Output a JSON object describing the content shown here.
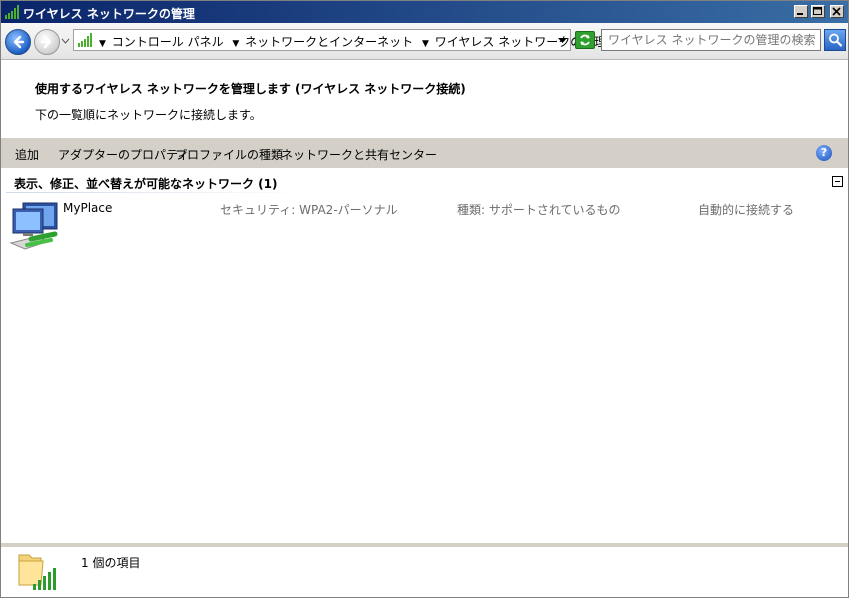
{
  "window": {
    "title": "ワイヤレス ネットワークの管理"
  },
  "address": {
    "crumbs": [
      "コントロール パネル",
      "ネットワークとインターネット",
      "ワイヤレス ネットワークの管理"
    ]
  },
  "search": {
    "placeholder": "ワイヤレス ネットワークの管理の検索"
  },
  "header": {
    "title": "使用するワイヤレス ネットワークを管理します (ワイヤレス ネットワーク接続)",
    "subtitle": "下の一覧順にネットワークに接続します。"
  },
  "toolbar": {
    "add": "追加",
    "adapter_properties": "アダプターのプロパティ",
    "profile_types": "プロファイルの種類",
    "network_center": "ネットワークと共有センター",
    "help": "?"
  },
  "group": {
    "title": "表示、修正、並べ替えが可能なネットワーク (1)"
  },
  "networks": [
    {
      "name": "MyPlace",
      "security": "セキュリティ: WPA2-パーソナル",
      "type": "種類: サポートされているもの",
      "connection": "自動的に接続する"
    }
  ],
  "details": {
    "count_text": "1 個の項目"
  },
  "icons": {
    "app": "wireless-network-icon",
    "back": "back-arrow-icon",
    "forward": "forward-arrow-icon",
    "refresh": "refresh-icon",
    "search": "search-icon",
    "network": "computer-network-icon",
    "details": "folder-signal-icon"
  },
  "colors": {
    "titlebar_start": "#0a246a",
    "titlebar_end": "#3a6ea5",
    "toolbar_bg": "#d4d0c8",
    "muted_text": "#6d6d6d"
  }
}
